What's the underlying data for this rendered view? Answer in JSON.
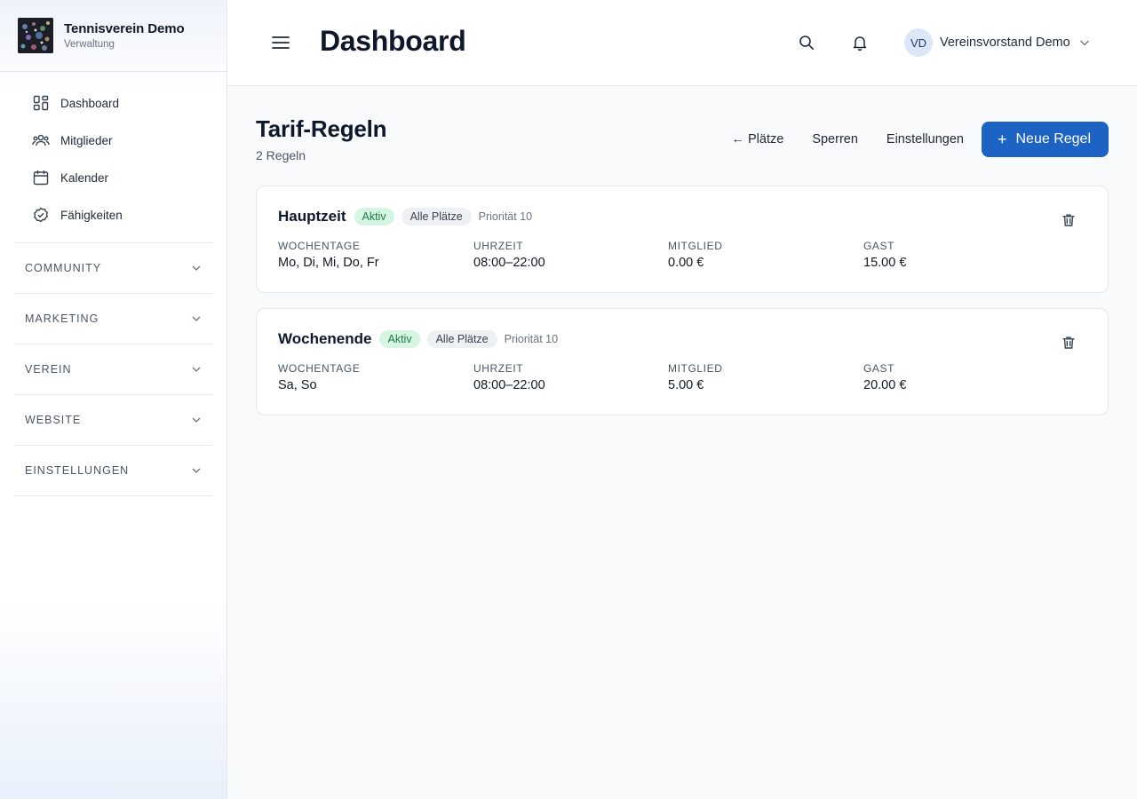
{
  "brand": {
    "name": "Tennisverein Demo",
    "subtitle": "Verwaltung"
  },
  "sidebar": {
    "items": [
      {
        "label": "Dashboard",
        "icon": "dashboard-icon"
      },
      {
        "label": "Mitglieder",
        "icon": "users-icon"
      },
      {
        "label": "Kalender",
        "icon": "calendar-icon"
      },
      {
        "label": "Fähigkeiten",
        "icon": "badge-check-icon"
      }
    ],
    "groups": [
      {
        "label": "COMMUNITY"
      },
      {
        "label": "MARKETING"
      },
      {
        "label": "VEREIN"
      },
      {
        "label": "WEBSITE"
      },
      {
        "label": "EINSTELLUNGEN"
      }
    ]
  },
  "header": {
    "title": "Dashboard",
    "user": {
      "initials": "VD",
      "name": "Vereinsvorstand Demo"
    }
  },
  "main": {
    "title": "Tarif-Regeln",
    "subtitle": "2 Regeln",
    "actions": {
      "back": "← Plätze",
      "locks": "Sperren",
      "settings": "Einstellungen",
      "new_rule": "Neue Regel",
      "new_rule_icon": "+"
    },
    "field_labels": {
      "weekdays": "WOCHENTAGE",
      "time": "UHRZEIT",
      "member": "MITGLIED",
      "guest": "GAST"
    },
    "rules": [
      {
        "name": "Hauptzeit",
        "status": "Aktiv",
        "courts": "Alle Plätze",
        "priority": "Priorität 10",
        "weekdays": "Mo, Di, Mi, Do, Fr",
        "time": "08:00–22:00",
        "member": "0.00 €",
        "guest": "15.00 €"
      },
      {
        "name": "Wochenende",
        "status": "Aktiv",
        "courts": "Alle Plätze",
        "priority": "Priorität 10",
        "weekdays": "Sa, So",
        "time": "08:00–22:00",
        "member": "5.00 €",
        "guest": "20.00 €"
      }
    ]
  },
  "colors": {
    "primary": "#1d63c4",
    "active_badge_bg": "#d6f5e3",
    "active_badge_text": "#1b7a48"
  }
}
